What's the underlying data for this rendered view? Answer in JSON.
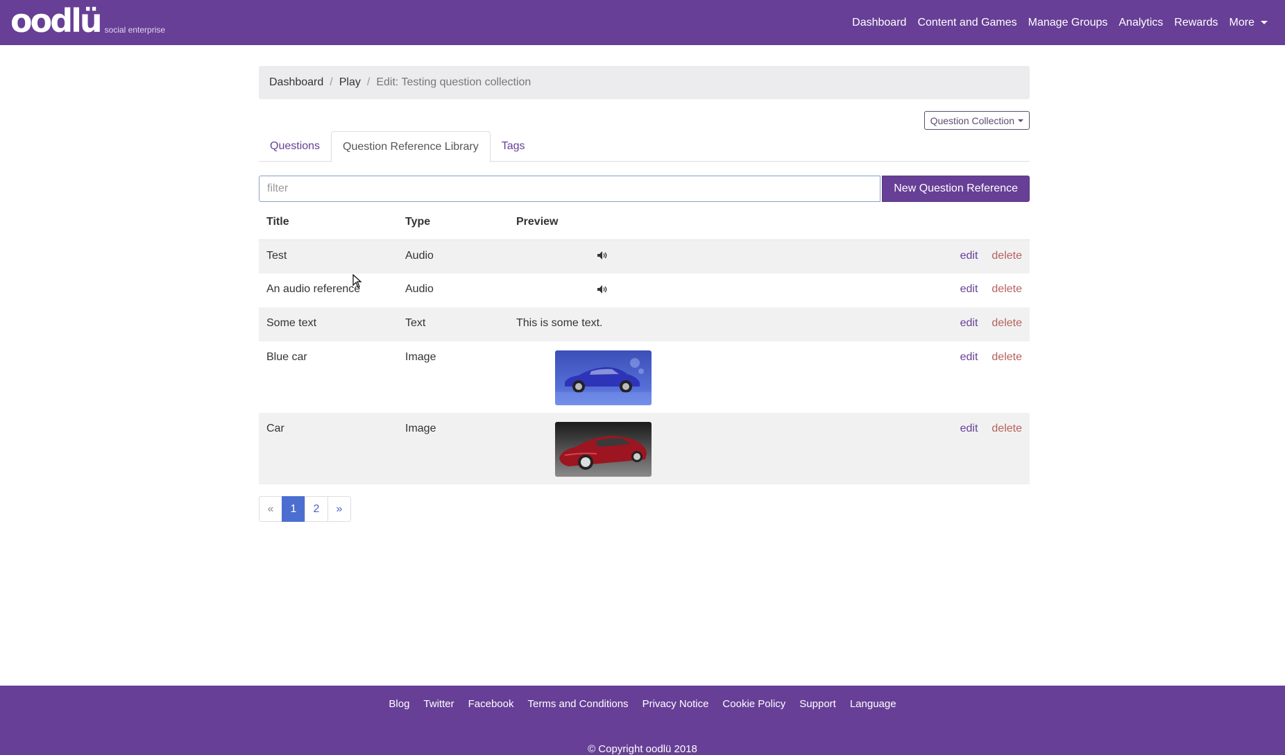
{
  "nav": {
    "brand": "oodlü",
    "brand_tagline": "social enterprise",
    "links": [
      "Dashboard",
      "Content and Games",
      "Manage Groups",
      "Analytics",
      "Rewards"
    ],
    "more_label": "More"
  },
  "breadcrumb": {
    "items": [
      "Dashboard",
      "Play"
    ],
    "active": "Edit: Testing question collection"
  },
  "collection_dropdown": {
    "label": "Question Collection"
  },
  "tabs": [
    {
      "label": "Questions",
      "active": false
    },
    {
      "label": "Question Reference Library",
      "active": true
    },
    {
      "label": "Tags",
      "active": false
    }
  ],
  "filter": {
    "placeholder": "filter",
    "value": ""
  },
  "new_button": "New Question Reference",
  "table": {
    "headers": [
      "Title",
      "Type",
      "Preview"
    ],
    "rows": [
      {
        "title": "Test",
        "type": "Audio",
        "preview_kind": "audio",
        "preview": "speaker-icon",
        "edit": "edit",
        "delete": "delete"
      },
      {
        "title": "An audio reference",
        "type": "Audio",
        "preview_kind": "audio",
        "preview": "speaker-icon",
        "edit": "edit",
        "delete": "delete"
      },
      {
        "title": "Some text",
        "type": "Text",
        "preview_kind": "text",
        "preview": "This is some text.",
        "edit": "edit",
        "delete": "delete"
      },
      {
        "title": "Blue car",
        "type": "Image",
        "preview_kind": "image",
        "preview": "blue-car-thumbnail",
        "edit": "edit",
        "delete": "delete"
      },
      {
        "title": "Car",
        "type": "Image",
        "preview_kind": "image",
        "preview": "red-car-thumbnail",
        "edit": "edit",
        "delete": "delete"
      }
    ]
  },
  "pagination": {
    "prev": "«",
    "pages": [
      "1",
      "2"
    ],
    "current": "1",
    "next": "»"
  },
  "footer": {
    "links": [
      "Blog",
      "Twitter",
      "Facebook",
      "Terms and Conditions",
      "Privacy Notice",
      "Cookie Policy",
      "Support",
      "Language"
    ],
    "copyright": "© Copyright oodlü 2018"
  },
  "colors": {
    "brand": "#673f96",
    "delete": "#b5615c",
    "active_page": "#4c6ed0"
  }
}
